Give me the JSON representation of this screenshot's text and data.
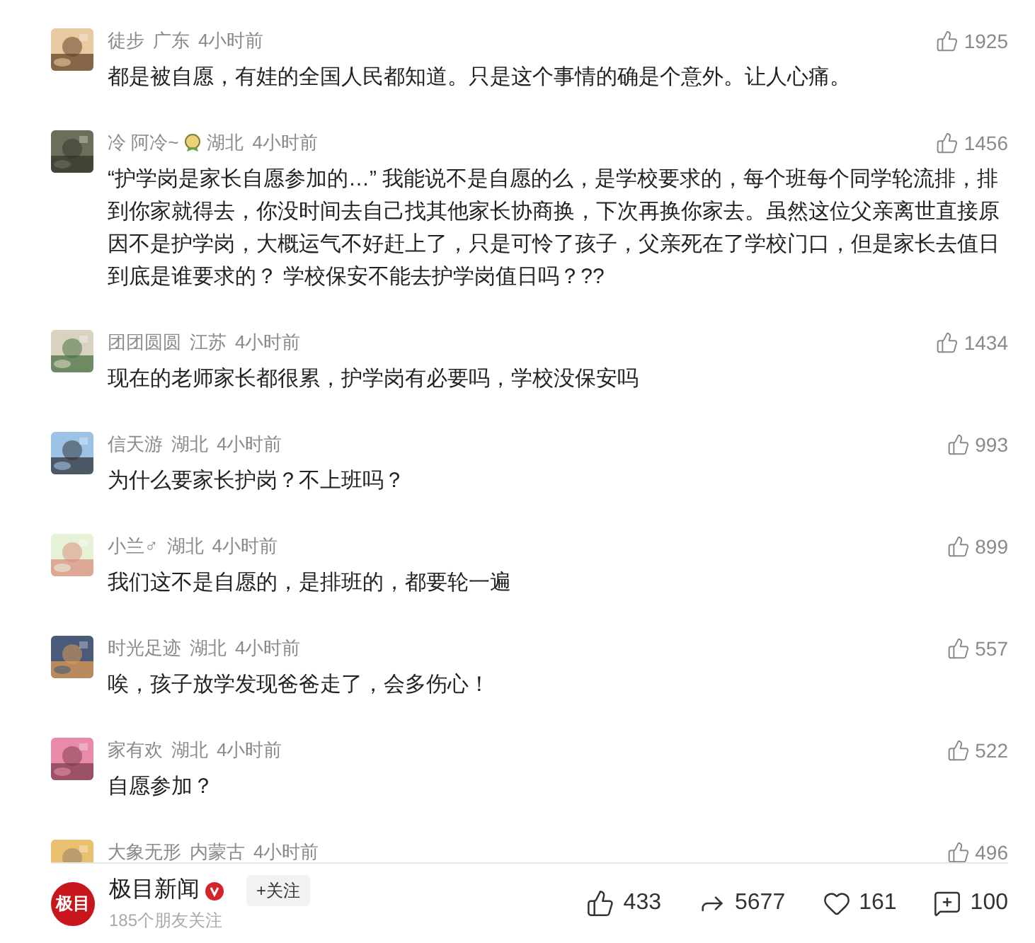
{
  "comments": [
    {
      "user": "徒步",
      "region": "广东",
      "time": "4小时前",
      "likes": "1925",
      "text": "都是被自愿，有娃的全国人民都知道。只是这个事情的确是个意外。让人心痛。",
      "badge": false
    },
    {
      "user": "冷 阿冷~",
      "region": "湖北",
      "time": "4小时前",
      "likes": "1456",
      "text": "“护学岗是家长自愿参加的…” 我能说不是自愿的么，是学校要求的，每个班每个同学轮流排，排到你家就得去，你没时间去自己找其他家长协商换，下次再换你家去。虽然这位父亲离世直接原因不是护学岗，大概运气不好赶上了，只是可怜了孩子，父亲死在了学校门口，但是家长去值日到底是谁要求的？ 学校保安不能去护学岗值日吗？??",
      "badge": true
    },
    {
      "user": "团团圆圆",
      "region": "江苏",
      "time": "4小时前",
      "likes": "1434",
      "text": "现在的老师家长都很累，护学岗有必要吗，学校没保安吗",
      "badge": false
    },
    {
      "user": "信天游",
      "region": "湖北",
      "time": "4小时前",
      "likes": "993",
      "text": "为什么要家长护岗？不上班吗？",
      "badge": false
    },
    {
      "user": "小兰♂",
      "region": "湖北",
      "time": "4小时前",
      "likes": "899",
      "text": "我们这不是自愿的，是排班的，都要轮一遍",
      "badge": false
    },
    {
      "user": "时光足迹",
      "region": "湖北",
      "time": "4小时前",
      "likes": "557",
      "text": "唉，孩子放学发现爸爸走了，会多伤心！",
      "badge": false
    },
    {
      "user": "家有欢",
      "region": "湖北",
      "time": "4小时前",
      "likes": "522",
      "text": "自愿参加？",
      "badge": false
    },
    {
      "user": "大象无形",
      "region": "内蒙古",
      "time": "4小时前",
      "likes": "496",
      "badge": false
    }
  ],
  "footer": {
    "logo": "极目",
    "source": "极目新闻",
    "verified": true,
    "follow_button": "+关注",
    "followers": "185个朋友关注",
    "stats": [
      {
        "kind": "like",
        "count": "433"
      },
      {
        "kind": "share",
        "count": "5677"
      },
      {
        "kind": "favorite",
        "count": "161"
      },
      {
        "kind": "comment",
        "count": "100"
      }
    ]
  }
}
